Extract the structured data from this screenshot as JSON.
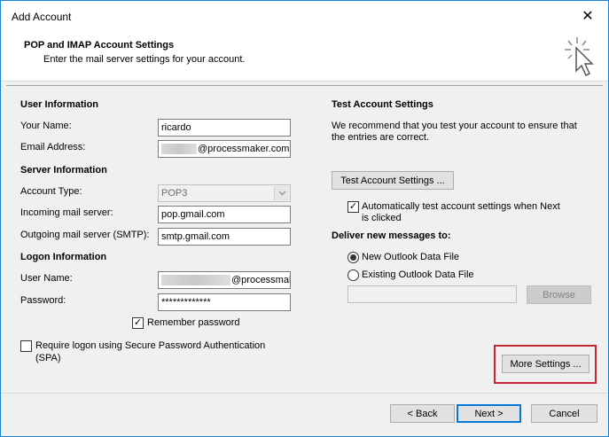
{
  "window": {
    "title": "Add Account",
    "close": "✕"
  },
  "header": {
    "title": "POP and IMAP Account Settings",
    "subtitle": "Enter the mail server settings for your account.",
    "icon": "cursor-sparkle-icon"
  },
  "user_info": {
    "heading": "User Information",
    "your_name_label": "Your Name:",
    "your_name_value": "ricardo",
    "email_label": "Email Address:",
    "email_value": "@processmaker.com"
  },
  "server_info": {
    "heading": "Server Information",
    "account_type_label": "Account Type:",
    "account_type_value": "POP3",
    "incoming_label": "Incoming mail server:",
    "incoming_value": "pop.gmail.com",
    "outgoing_label": "Outgoing mail server (SMTP):",
    "outgoing_value": "smtp.gmail.com"
  },
  "logon_info": {
    "heading": "Logon Information",
    "username_label": "User Name:",
    "username_value": "@processmal",
    "password_label": "Password:",
    "password_value": "*************",
    "remember_label": "Remember password",
    "remember_checked": "✓",
    "spa_label_line1": "Require logon using Secure Password Authentication",
    "spa_label_line2": "(SPA)"
  },
  "test_settings": {
    "heading": "Test Account Settings",
    "desc_line1": "We recommend that you test your account to ensure that",
    "desc_line2": "the entries are correct.",
    "test_button": "Test Account Settings ...",
    "auto_test_line1": "Automatically test account settings when Next",
    "auto_test_line2": "is clicked",
    "auto_test_checked": "✓"
  },
  "deliver": {
    "heading": "Deliver new messages to:",
    "new_file": "New Outlook Data File",
    "existing_file": "Existing Outlook Data File",
    "browse_button": "Browse"
  },
  "more_settings_button": "More Settings ...",
  "footer": {
    "back": "< Back",
    "next": "Next >",
    "cancel": "Cancel"
  }
}
